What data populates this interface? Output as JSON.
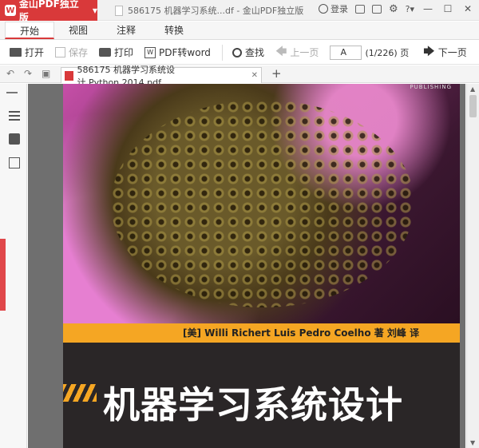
{
  "titlebar": {
    "app_name": "金山PDF独立版",
    "window_title": "586175 机器学习系统...df - 金山PDF独立版",
    "login_label": "登录",
    "help_label": "?▾"
  },
  "menu": {
    "tabs": [
      "开始",
      "视图",
      "注释",
      "转换"
    ],
    "active": "开始"
  },
  "toolbar": {
    "open_label": "打开",
    "save_label": "保存",
    "print_label": "打印",
    "convert_label": "PDF转word",
    "find_label": "查找",
    "prev_label": "上一页",
    "page_value": "A",
    "page_count": "(1/226) 页",
    "next_label": "下一页"
  },
  "tabbar": {
    "doc_tab_label": "586175 机器学习系统设计.Python.2014.pdf",
    "new_tab": "+"
  },
  "cover": {
    "publisher_mark": "PUBLISHING",
    "authors": "[美] Willi Richert   Luis Pedro Coelho  著     刘峰  译",
    "title": "机器学习系统设计"
  },
  "colors": {
    "accent": "#d9393a",
    "orange": "#f5a623",
    "page_bg": "#2a2627"
  }
}
